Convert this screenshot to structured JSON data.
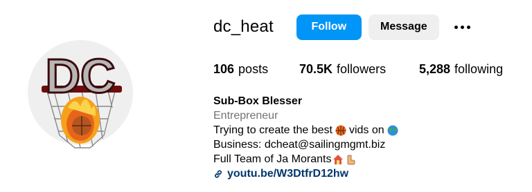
{
  "profile": {
    "username": "dc_heat",
    "avatar_logo_text": "DC",
    "follow_label": "Follow",
    "message_label": "Message",
    "more_icon": "more-horizontal-icon"
  },
  "stats": {
    "posts_count": "106",
    "posts_label": "posts",
    "followers_count": "70.5K",
    "followers_label": "followers",
    "following_count": "5,288",
    "following_label": "following"
  },
  "bio": {
    "name": "Sub-Box Blesser",
    "category": "Entrepreneur",
    "line1_prefix": "Trying to create the best",
    "line1_middle": "vids on",
    "line1_emojis": [
      "basketball-emoji",
      "globe-emoji"
    ],
    "line2": "Business: dcheat@sailingmgmt.biz",
    "line3": "Full Team of Ja Morants",
    "line3_emojis": [
      "house-emoji",
      "pointing-finger-emoji"
    ],
    "link_icon": "link-icon",
    "link": "youtu.be/W3DtfrD12hw"
  },
  "colors": {
    "follow_bg": "#0095f6",
    "message_bg": "#efefef",
    "category_text": "#737373",
    "link_text": "#00376b"
  }
}
